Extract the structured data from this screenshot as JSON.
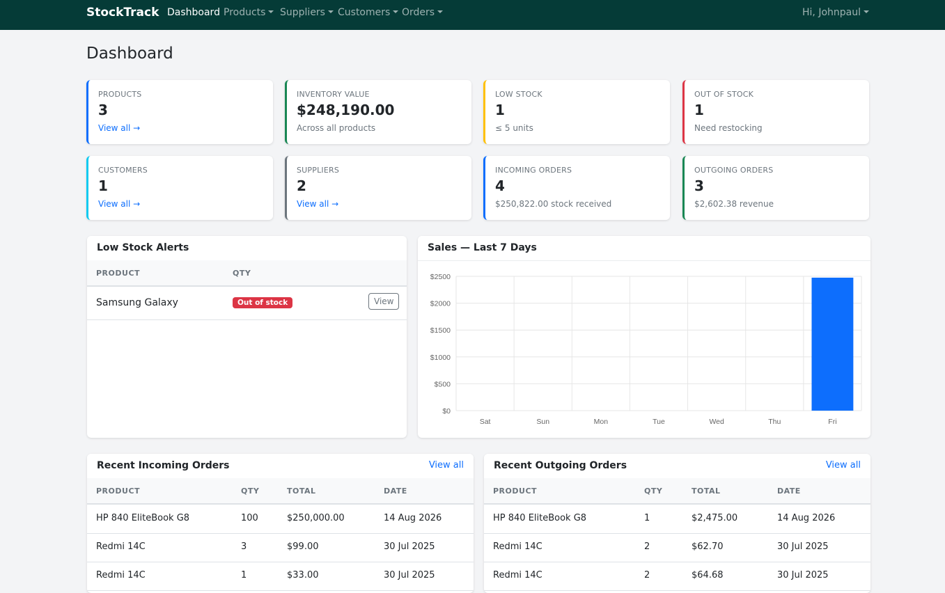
{
  "nav": {
    "brand": "StockTrack",
    "items": [
      {
        "label": "Dashboard"
      },
      {
        "label": "Products"
      },
      {
        "label": "Suppliers"
      },
      {
        "label": "Customers"
      },
      {
        "label": "Orders"
      }
    ],
    "user": "Hi, Johnpaul"
  },
  "page_title": "Dashboard",
  "stats": [
    {
      "label": "PRODUCTS",
      "value": "3",
      "link": "View all →",
      "accent": "#0d6efd"
    },
    {
      "label": "INVENTORY VALUE",
      "value": "$248,190.00",
      "sub": "Across all products",
      "accent": "#198754"
    },
    {
      "label": "LOW STOCK",
      "value": "1",
      "sub": "≤ 5 units",
      "accent": "#ffc107"
    },
    {
      "label": "OUT OF STOCK",
      "value": "1",
      "sub": "Need restocking",
      "accent": "#dc3545"
    },
    {
      "label": "CUSTOMERS",
      "value": "1",
      "link": "View all →",
      "accent": "#0dcaf0"
    },
    {
      "label": "SUPPLIERS",
      "value": "2",
      "link": "View all →",
      "accent": "#6c757d"
    },
    {
      "label": "INCOMING ORDERS",
      "value": "4",
      "sub": "$250,822.00 stock received",
      "accent": "#0d6efd"
    },
    {
      "label": "OUTGOING ORDERS",
      "value": "3",
      "sub": "$2,602.38 revenue",
      "accent": "#198754"
    }
  ],
  "low_stock": {
    "title": "Low Stock Alerts",
    "columns": [
      "PRODUCT",
      "QTY"
    ],
    "rows": [
      {
        "product": "Samsung Galaxy",
        "badge": "Out of stock",
        "action": "View"
      }
    ]
  },
  "sales": {
    "title": "Sales — Last 7 Days"
  },
  "chart_data": {
    "type": "bar",
    "categories": [
      "Sat",
      "Sun",
      "Mon",
      "Tue",
      "Wed",
      "Thu",
      "Fri"
    ],
    "values": [
      0,
      0,
      0,
      0,
      0,
      0,
      2475
    ],
    "yticks": [
      "$0",
      "$500",
      "$1000",
      "$1500",
      "$2000",
      "$2500"
    ],
    "ylim": [
      0,
      2500
    ],
    "bar_color": "#0d6efd",
    "grid": true,
    "legend": false
  },
  "incoming": {
    "title": "Recent Incoming Orders",
    "link": "View all",
    "columns": [
      "PRODUCT",
      "QTY",
      "TOTAL",
      "DATE"
    ],
    "rows": [
      [
        "HP 840 EliteBook G8",
        "100",
        "$250,000.00",
        "14 Aug 2026"
      ],
      [
        "Redmi 14C",
        "3",
        "$99.00",
        "30 Jul 2025"
      ],
      [
        "Redmi 14C",
        "1",
        "$33.00",
        "30 Jul 2025"
      ]
    ]
  },
  "outgoing": {
    "title": "Recent Outgoing Orders",
    "link": "View all",
    "columns": [
      "PRODUCT",
      "QTY",
      "TOTAL",
      "DATE"
    ],
    "rows": [
      [
        "HP 840 EliteBook G8",
        "1",
        "$2,475.00",
        "14 Aug 2026"
      ],
      [
        "Redmi 14C",
        "2",
        "$62.70",
        "30 Jul 2025"
      ],
      [
        "Redmi 14C",
        "2",
        "$64.68",
        "30 Jul 2025"
      ]
    ]
  }
}
